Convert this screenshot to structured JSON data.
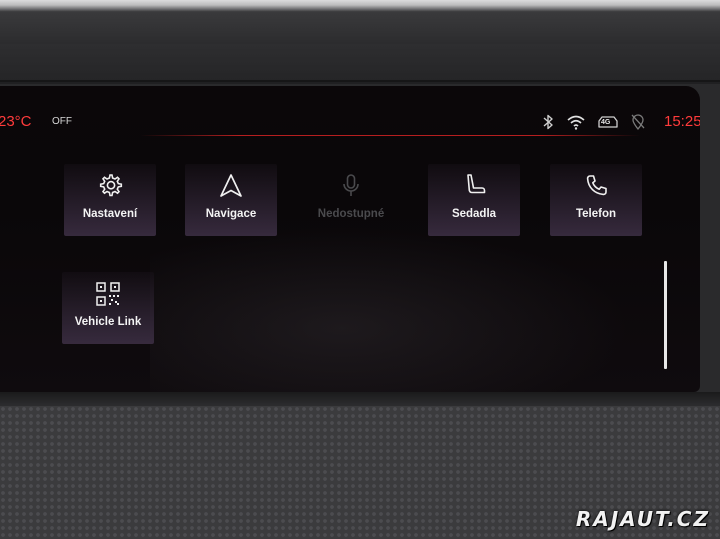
{
  "status": {
    "temperature": "23°C",
    "ac_state": "OFF",
    "clock": "15:25",
    "indicators": [
      "bluetooth-icon",
      "wifi-icon",
      "4g-icon",
      "location-off-icon"
    ],
    "network_badge": "4G"
  },
  "apps": [
    {
      "label": "Nastavení",
      "icon": "gear-icon",
      "enabled": true
    },
    {
      "label": "Navigace",
      "icon": "navigation-arrow-icon",
      "enabled": true
    },
    {
      "label": "Nedostupné",
      "icon": "microphone-icon",
      "enabled": false
    },
    {
      "label": "Sedadla",
      "icon": "seat-icon",
      "enabled": true
    },
    {
      "label": "Telefon",
      "icon": "phone-icon",
      "enabled": true
    },
    {
      "label": "Vehicle Link",
      "icon": "qr-code-icon",
      "enabled": true
    }
  ],
  "watermark": "RAJAUT.CZ",
  "colors": {
    "accent": "#ff3b3b",
    "tile": "#3e3046",
    "disabled": "#4a4a4d"
  }
}
